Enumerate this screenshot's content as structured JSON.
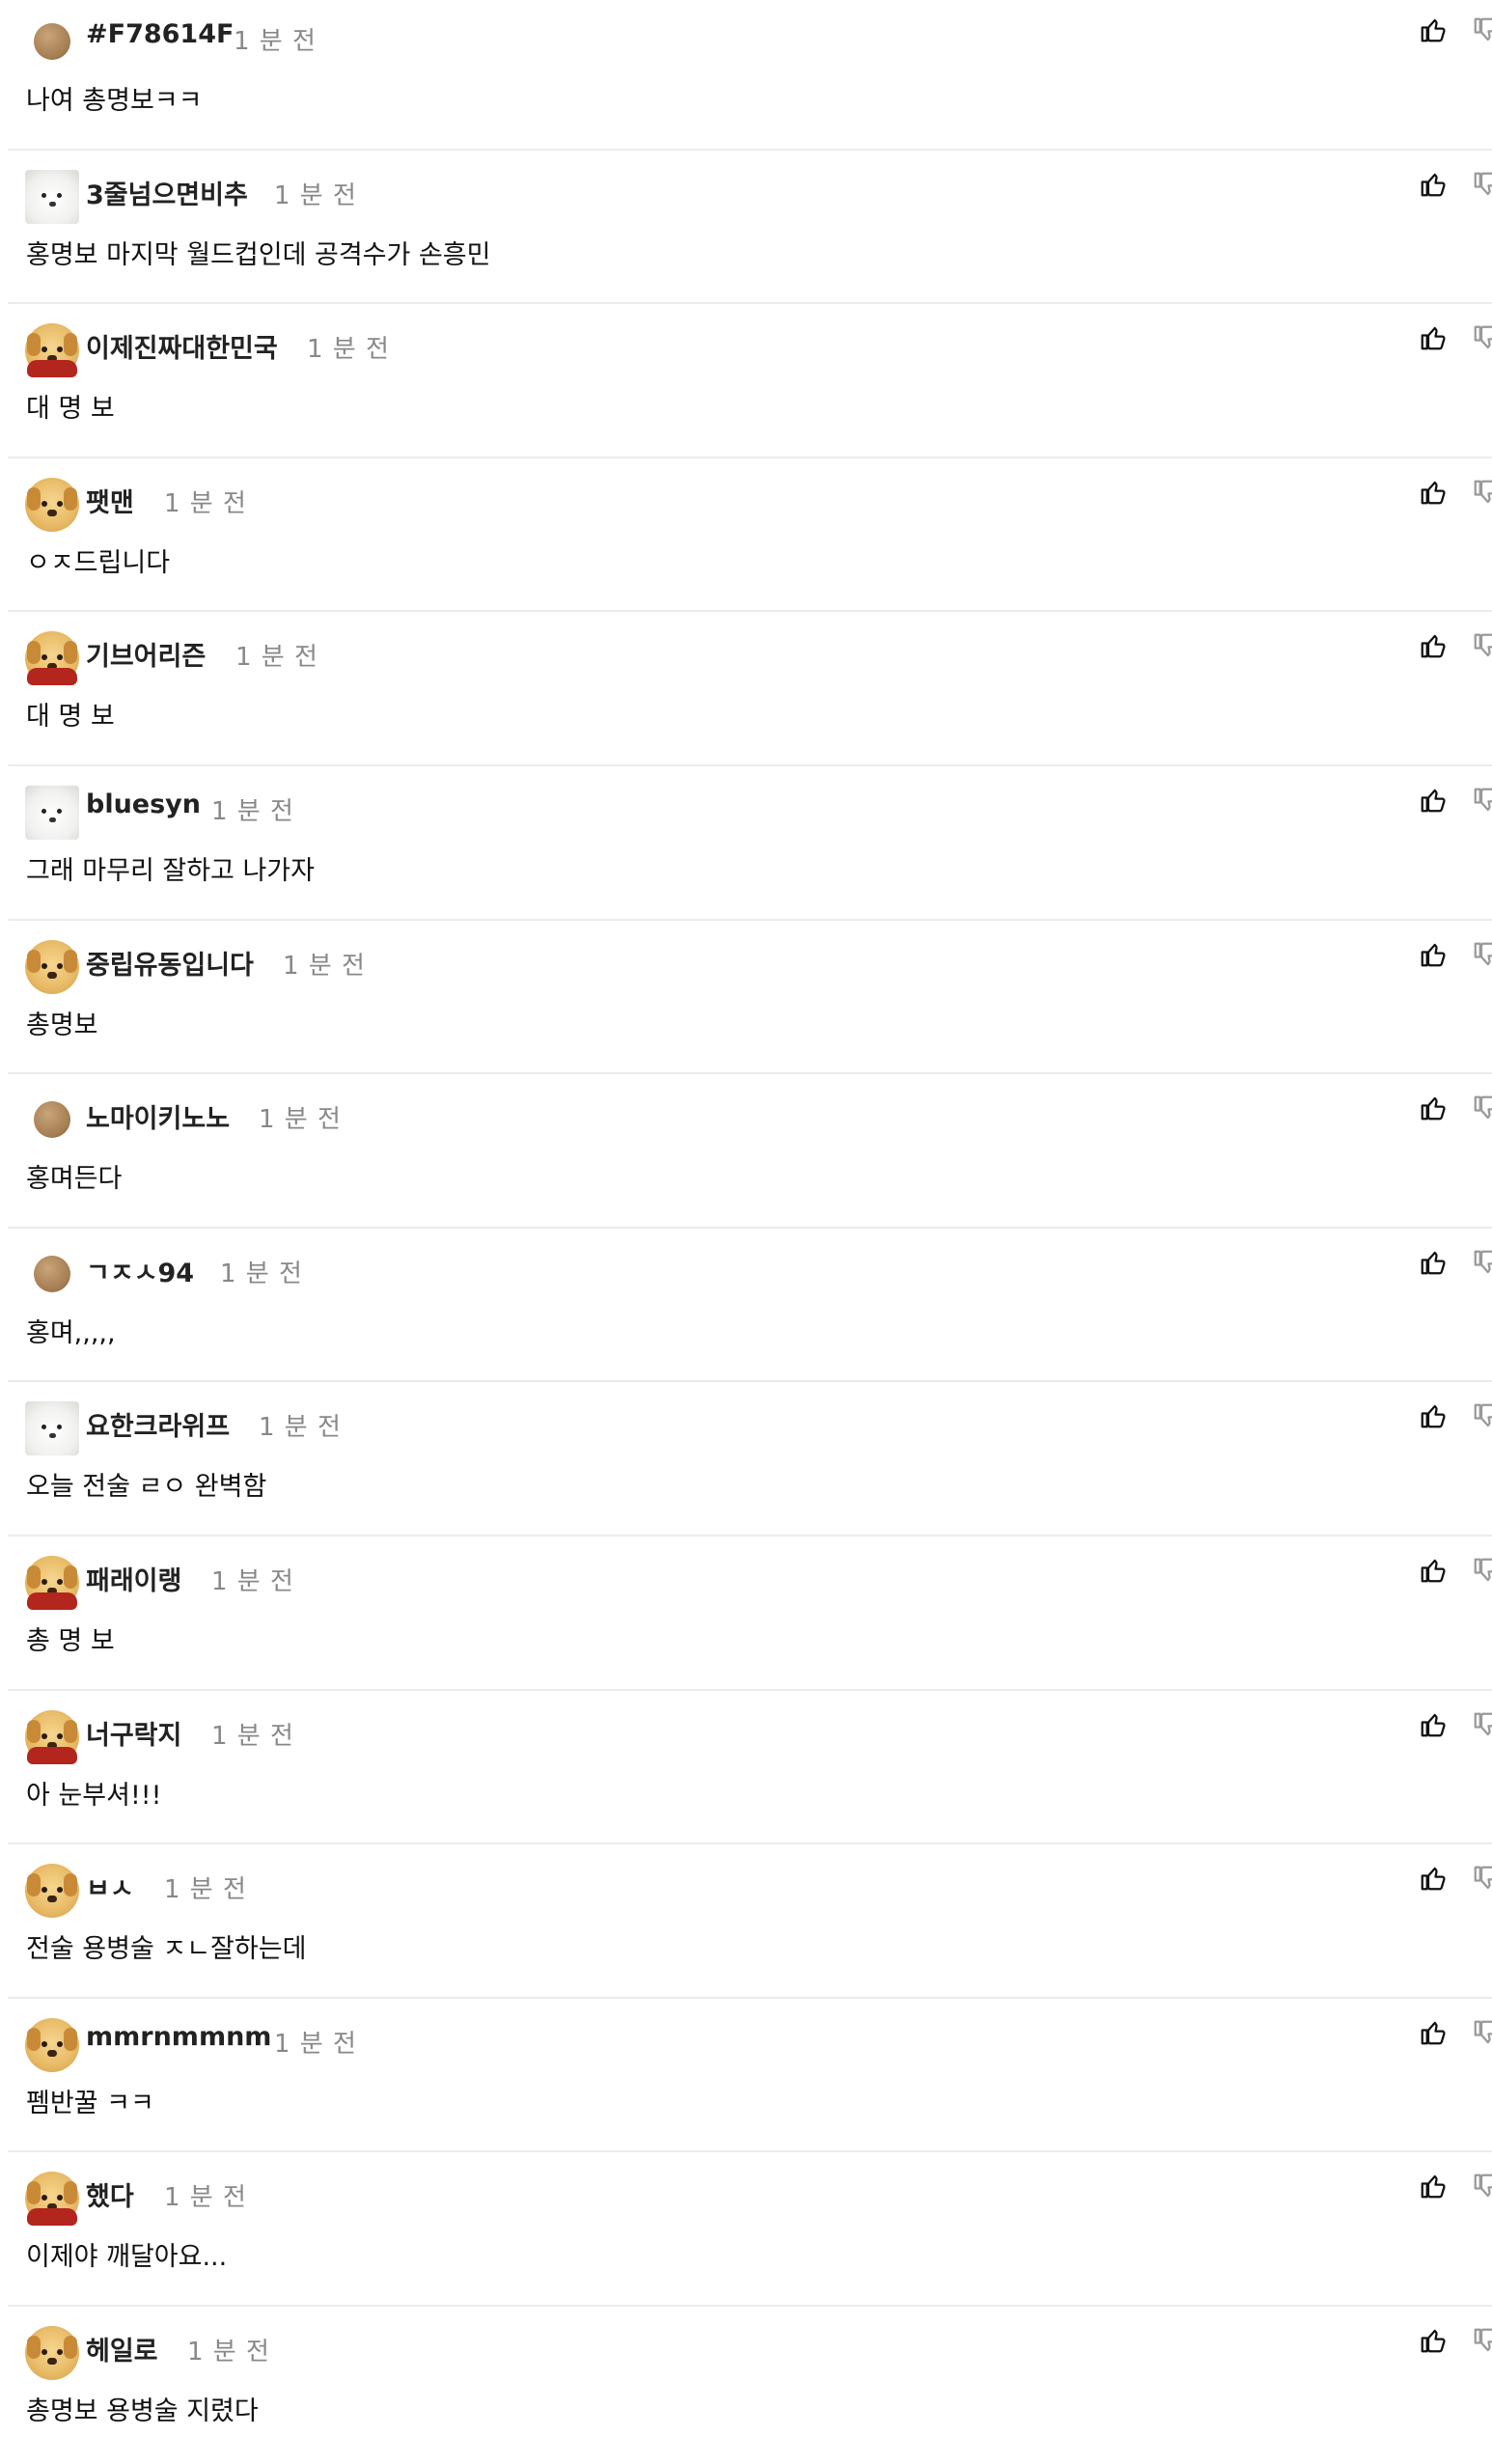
{
  "comments": [
    {
      "avatar": "bead",
      "username": "#F78614F",
      "time": "1 분 전",
      "text": "나여 총명보ㅋㅋ"
    },
    {
      "avatar": "white-dog",
      "username": "3줄넘으면비추",
      "time": "1 분 전",
      "text": "홍명보 마지막 월드컵인데 공격수가 손흥민"
    },
    {
      "avatar": "puppy-red",
      "username": "이제진짜대한민국",
      "time": "1 분 전",
      "text": "대 명 보"
    },
    {
      "avatar": "puppy",
      "username": "팻맨",
      "time": "1 분 전",
      "text": "ㅇㅈ드립니다"
    },
    {
      "avatar": "puppy-red",
      "username": "기브어리즌",
      "time": "1 분 전",
      "text": "대 명 보"
    },
    {
      "avatar": "white-dog",
      "username": "bluesyn",
      "time": "1 분 전",
      "text": "그래 마무리 잘하고 나가자"
    },
    {
      "avatar": "puppy",
      "username": "중립유동입니다",
      "time": "1 분 전",
      "text": "총명보"
    },
    {
      "avatar": "bead",
      "username": "노마이키노노",
      "time": "1 분 전",
      "text": "홍며든다"
    },
    {
      "avatar": "bead",
      "username": "ㄱㅈㅅ94",
      "time": "1 분 전",
      "text": "홍며,,,,,"
    },
    {
      "avatar": "white-dog",
      "username": "요한크라위프",
      "time": "1 분 전",
      "text": "오늘 전술 ㄹㅇ 완벽함"
    },
    {
      "avatar": "puppy-red",
      "username": "패래이랭",
      "time": "1 분 전",
      "text": "총 명 보"
    },
    {
      "avatar": "puppy-red",
      "username": "너구락지",
      "time": "1 분 전",
      "text": "아 눈부셔!!!"
    },
    {
      "avatar": "puppy",
      "username": "ㅂㅅ",
      "time": "1 분 전",
      "text": "전술 용병술 ㅈㄴ잘하는데"
    },
    {
      "avatar": "puppy",
      "username": "mmrnmmnm",
      "time": "1 분 전",
      "text": "펨반꿀 ㅋㅋ"
    },
    {
      "avatar": "puppy-red",
      "username": "했다",
      "time": "1 분 전",
      "text": "이제야 깨달아요..."
    },
    {
      "avatar": "puppy",
      "username": "헤일로",
      "time": "1 분 전",
      "text": "총명보 용병술 지렸다"
    }
  ],
  "icons": {
    "like": "thumbs-up-icon",
    "dislike": "thumbs-down-icon"
  },
  "colors": {
    "username": "#222222",
    "timestamp": "#888888",
    "divider": "#ececec",
    "text": "#111111"
  }
}
